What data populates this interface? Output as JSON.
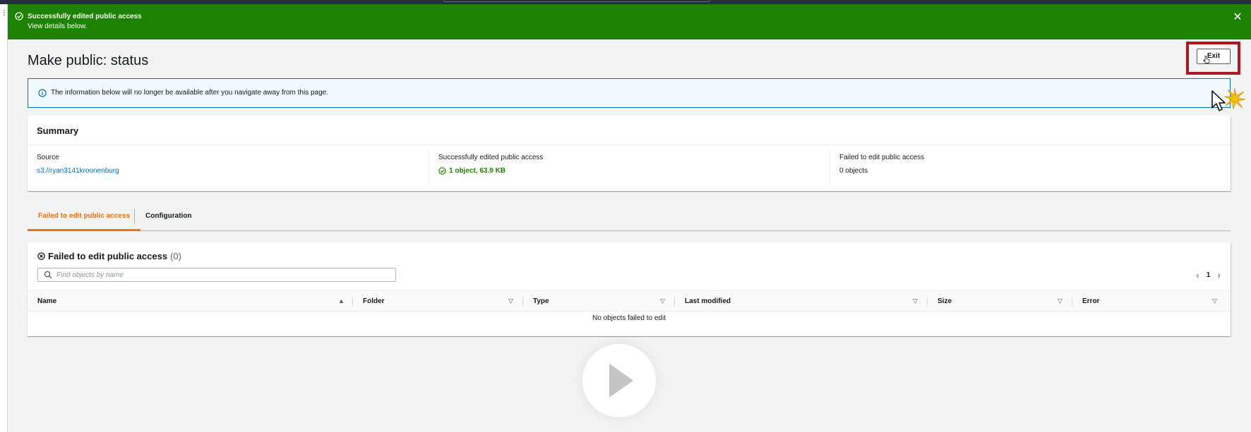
{
  "flash": {
    "title": "Successfully edited public access",
    "subtitle": "View details below."
  },
  "page": {
    "title": "Make public: status",
    "exit_label": "Exit"
  },
  "info": {
    "message": "The information below will no longer be available after you navigate away from this page."
  },
  "summary": {
    "heading": "Summary",
    "source_label": "Source",
    "source_value": "s3://ryan3141kroonenburg",
    "success_label": "Successfully edited public access",
    "success_value": "1 object, 63.9 KB",
    "failed_label": "Failed to edit public access",
    "failed_value": "0 objects"
  },
  "tabs": [
    {
      "label": "Failed to edit public access",
      "active": true
    },
    {
      "label": "Configuration",
      "active": false
    }
  ],
  "table": {
    "title": "Failed to edit public access",
    "count": "(0)",
    "search_placeholder": "Find objects by name",
    "page": "1",
    "columns": [
      "Name",
      "Folder",
      "Type",
      "Last modified",
      "Size",
      "Error"
    ],
    "empty_message": "No objects failed to edit"
  },
  "colors": {
    "success_green": "#1d8102",
    "link_blue": "#0073bb",
    "tab_orange": "#ec7211",
    "highlight_red": "#b0161f"
  }
}
